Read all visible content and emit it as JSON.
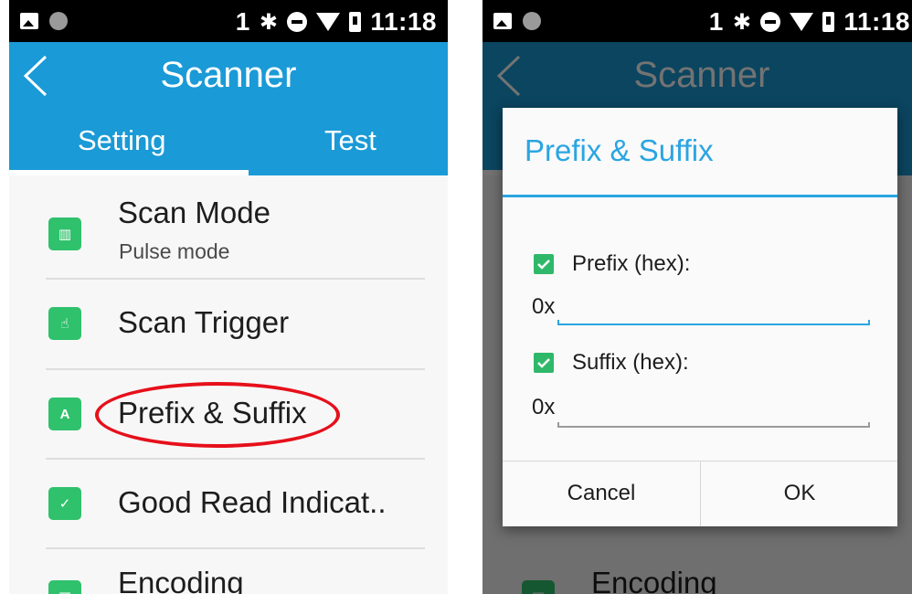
{
  "status_bar": {
    "sim": "1",
    "time": "11:18"
  },
  "app_bar": {
    "title": "Scanner",
    "tabs": [
      "Setting",
      "Test"
    ]
  },
  "list": {
    "items": [
      {
        "title": "Scan Mode",
        "subtitle": "Pulse mode",
        "icon": "barcode-icon"
      },
      {
        "title": "Scan Trigger",
        "icon": "scan-trigger-icon"
      },
      {
        "title": "Prefix & Suffix",
        "icon": "prefix-suffix-icon",
        "highlighted": true
      },
      {
        "title": "Good Read Indicat..",
        "icon": "good-read-icon"
      },
      {
        "title": "Encoding",
        "icon": "encoding-icon"
      }
    ]
  },
  "dialog": {
    "title": "Prefix & Suffix",
    "prefix": {
      "label": "Prefix (hex):",
      "checked": true,
      "hex_prefix": "0x",
      "value": ""
    },
    "suffix": {
      "label": "Suffix (hex):",
      "checked": true,
      "hex_prefix": "0x",
      "value": ""
    },
    "cancel_label": "Cancel",
    "ok_label": "OK"
  },
  "colors": {
    "accent": "#1a9ad6",
    "highlight": "#e6101b",
    "checkbox": "#2fb86a",
    "icon": "#2fc16c"
  }
}
